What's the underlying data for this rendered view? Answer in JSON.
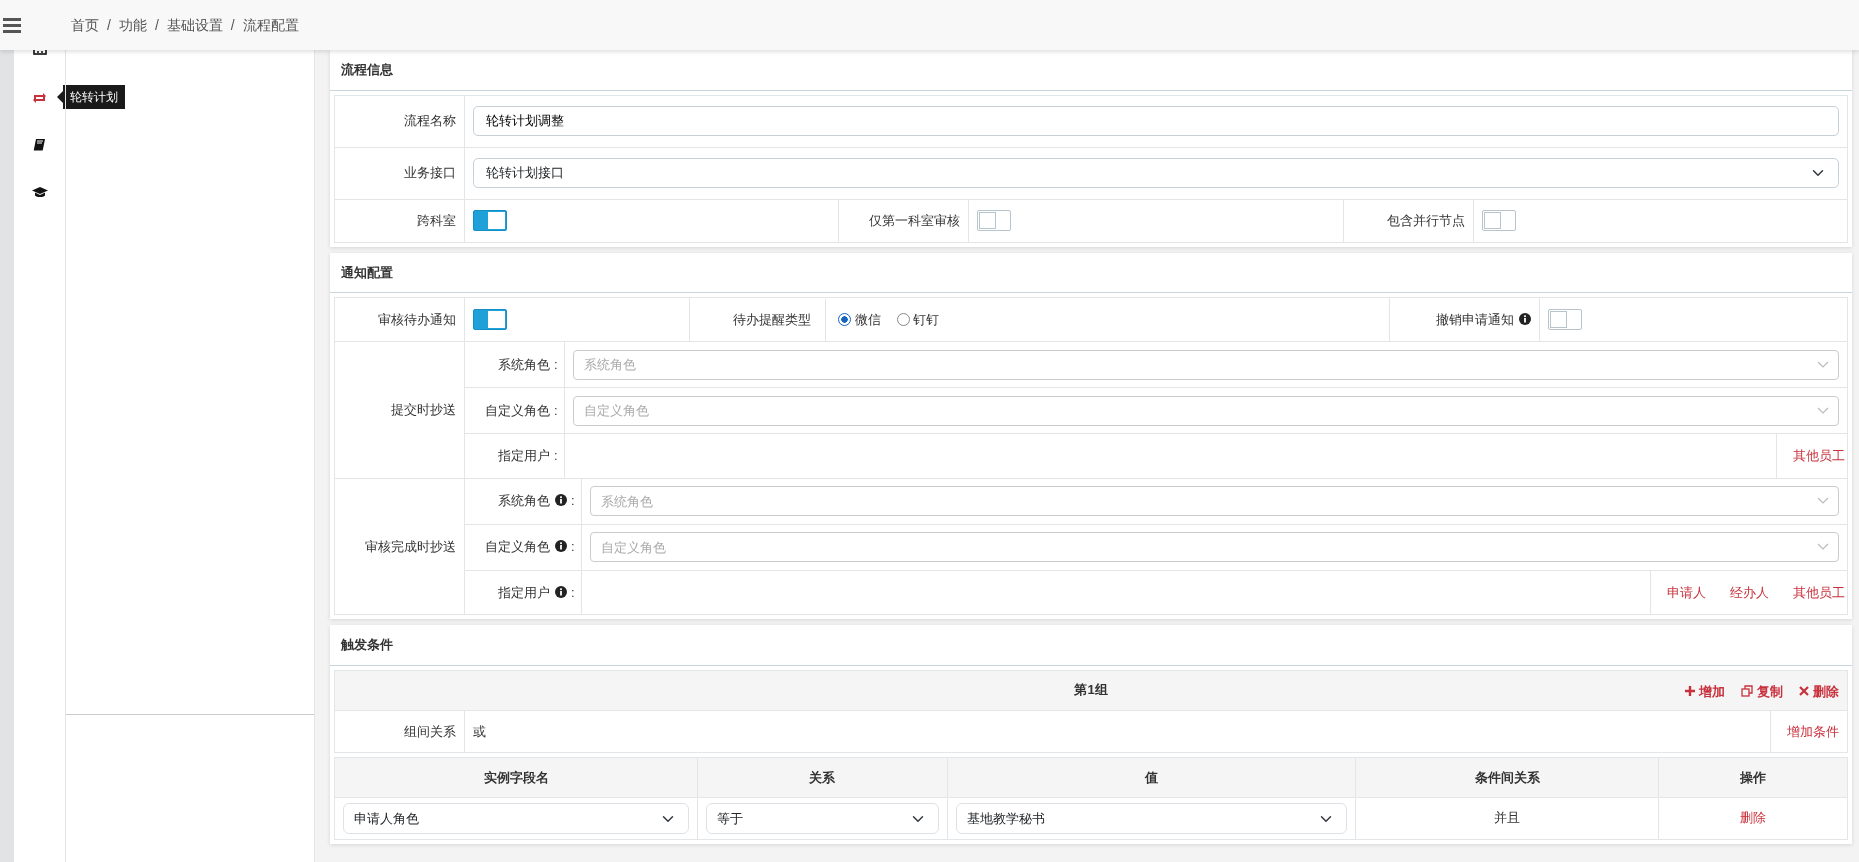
{
  "header": {
    "breadcrumb": [
      "首页",
      "功能",
      "基础设置",
      "流程配置"
    ],
    "separators": [
      "/",
      "/",
      "/"
    ]
  },
  "rail": {
    "items": [
      {
        "kind": "calendar",
        "selected": false
      },
      {
        "kind": "rotate",
        "selected": true,
        "tooltip": "轮转计划"
      },
      {
        "kind": "book",
        "selected": false
      },
      {
        "kind": "cap",
        "selected": false
      }
    ]
  },
  "process_info": {
    "title": "流程信息",
    "name_label": "流程名称",
    "name_value": "轮转计划调整",
    "interface_label": "业务接口",
    "interface_value": "轮转计划接口",
    "toggles": [
      {
        "label": "跨科室",
        "on": true
      },
      {
        "label": "仅第一科室审核",
        "on": false
      },
      {
        "label": "包含并行节点",
        "on": false
      }
    ]
  },
  "notify": {
    "title": "通知配置",
    "todo": {
      "label": "审核待办通知",
      "on": true
    },
    "remind_label": "待办提醒类型",
    "remind_options": [
      {
        "label": "微信",
        "selected": true
      },
      {
        "label": "钉钉",
        "selected": false
      }
    ],
    "cancel": {
      "label": "撤销申请通知",
      "on": false
    },
    "cc_groups": [
      {
        "label": "提交时抄送",
        "rows": [
          {
            "kind": "select",
            "label": "系统角色",
            "info": false,
            "colon": ":",
            "placeholder": "系统角色"
          },
          {
            "kind": "select",
            "label": "自定义角色",
            "info": false,
            "colon": ":",
            "placeholder": "自定义角色"
          },
          {
            "kind": "users",
            "label": "指定用户",
            "info": false,
            "colon": ":",
            "links": [
              "其他员工"
            ]
          }
        ]
      },
      {
        "label": "审核完成时抄送",
        "rows": [
          {
            "kind": "select",
            "label": "系统角色",
            "info": true,
            "colon": ":",
            "placeholder": "系统角色"
          },
          {
            "kind": "select",
            "label": "自定义角色",
            "info": true,
            "colon": ":",
            "placeholder": "自定义角色"
          },
          {
            "kind": "users",
            "label": "指定用户",
            "info": true,
            "colon": ":",
            "links": [
              "申请人",
              "经办人",
              "其他员工"
            ]
          }
        ]
      }
    ]
  },
  "trigger": {
    "title": "触发条件",
    "groups": [
      {
        "title": "第1组",
        "actions": [
          {
            "kind": "plus",
            "label": "增加"
          },
          {
            "kind": "copy",
            "label": "复制"
          },
          {
            "kind": "times",
            "label": "删除"
          }
        ],
        "relation_label": "组间关系",
        "relation_value": "或",
        "add_condition": "增加条件",
        "columns": [
          "实例字段名",
          "关系",
          "值",
          "条件间关系",
          "操作"
        ],
        "rows": [
          {
            "field": "申请人角色",
            "relation": "等于",
            "value": "基地教学秘书",
            "join": "并且",
            "action": "删除"
          }
        ]
      }
    ]
  }
}
